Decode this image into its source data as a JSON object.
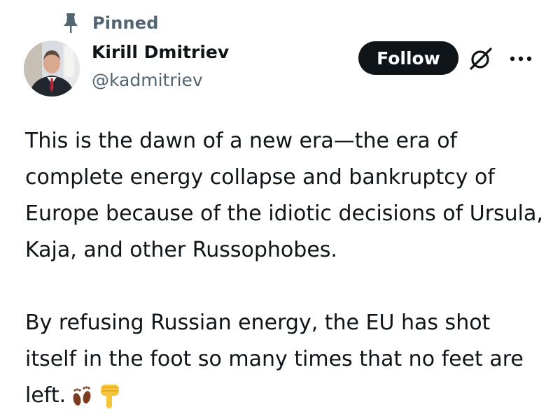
{
  "header": {
    "pinned_label": "Pinned"
  },
  "author": {
    "name": "Kirill Dmitriev",
    "handle": "@kadmitriev"
  },
  "actions": {
    "follow_label": "Follow",
    "grok_icon": "grok-icon",
    "more_icon": "more-icon",
    "follow_bg": "#0f1419"
  },
  "tweet": {
    "paragraphs": [
      "This is the dawn of a new era—the era of complete energy collapse and bankruptcy of Europe because of the idiotic decisions of Ursula, Kaja, and other Russophobes.",
      "By refusing Russian energy, the EU has shot itself in the foot so many times that no feet are left."
    ],
    "emojis": [
      "footprints-icon",
      "pointing-down-icon"
    ]
  },
  "colors": {
    "text_primary": "#0f1419",
    "text_secondary": "#536471"
  }
}
